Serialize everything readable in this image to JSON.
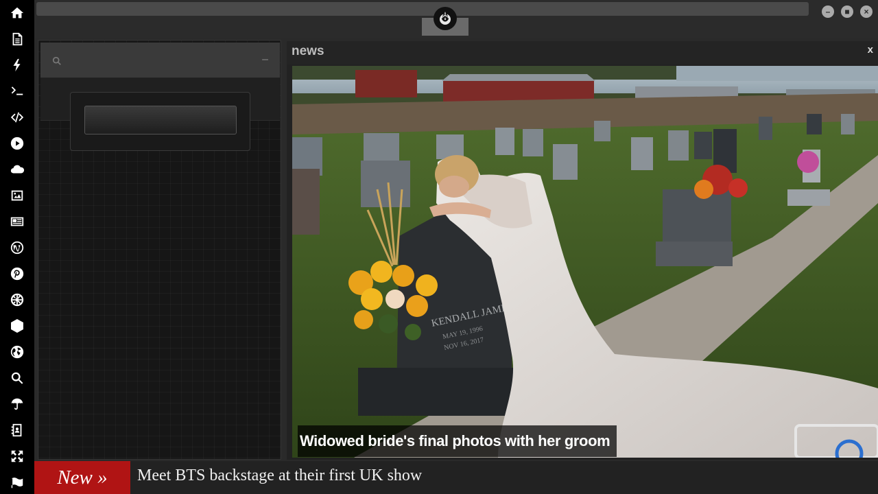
{
  "sidebar": {
    "items": [
      {
        "icon": "home-icon"
      },
      {
        "icon": "document-icon"
      },
      {
        "icon": "bolt-icon"
      },
      {
        "icon": "terminal-icon"
      },
      {
        "icon": "code-icon"
      },
      {
        "icon": "play-icon"
      },
      {
        "icon": "cloud-icon"
      },
      {
        "icon": "image-icon"
      },
      {
        "icon": "newspaper-icon"
      },
      {
        "icon": "wordpress-icon"
      },
      {
        "icon": "pinterest-icon"
      },
      {
        "icon": "galactic-empire-icon"
      },
      {
        "icon": "network-globe-icon"
      },
      {
        "icon": "globe-icon"
      },
      {
        "icon": "search-icon"
      },
      {
        "icon": "umbrella-icon"
      },
      {
        "icon": "contacts-icon"
      },
      {
        "icon": "expand-icon"
      },
      {
        "icon": "flag-icon"
      }
    ]
  },
  "header": {
    "logo": "rebel-alliance-icon",
    "window_buttons": [
      "minimize",
      "maximize",
      "close"
    ]
  },
  "search": {
    "value": "",
    "placeholder": "",
    "minimize_glyph": "–"
  },
  "news": {
    "title": "news",
    "close_glyph": "x",
    "caption": "Widowed bride's final photos with her groom",
    "headstone_name": "KENDALL JAMES",
    "headstone_date1": "MAY 19, 1996",
    "headstone_date2": "NOV 16, 2017"
  },
  "ticker": {
    "label": "New »",
    "text": "Meet BTS backstage at their first UK show"
  },
  "colors": {
    "sidebar_bg": "#000000",
    "ticker_label_bg": "#b01414",
    "panel_bg": "#161616"
  }
}
